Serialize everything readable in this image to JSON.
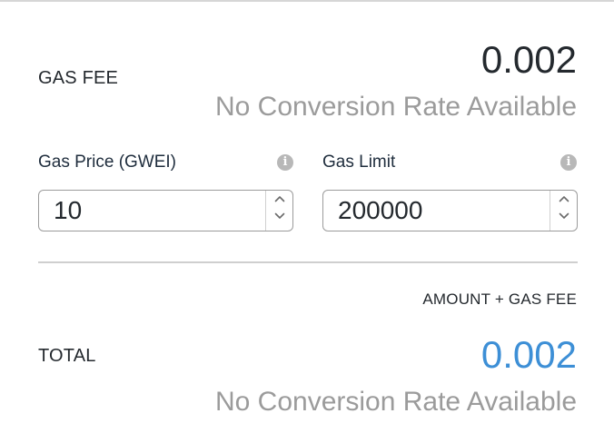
{
  "gas_fee": {
    "label": "GAS FEE",
    "value": "0.002",
    "conversion": "No Conversion Rate Available"
  },
  "gas_price": {
    "label": "Gas Price (GWEI)",
    "value": "10",
    "info_icon": "info-icon"
  },
  "gas_limit": {
    "label": "Gas Limit",
    "value": "200000",
    "info_icon": "info-icon"
  },
  "total": {
    "caption": "AMOUNT + GAS FEE",
    "label": "TOTAL",
    "value": "0.002",
    "conversion": "No Conversion Rate Available",
    "value_color": "#3d8fd6"
  }
}
